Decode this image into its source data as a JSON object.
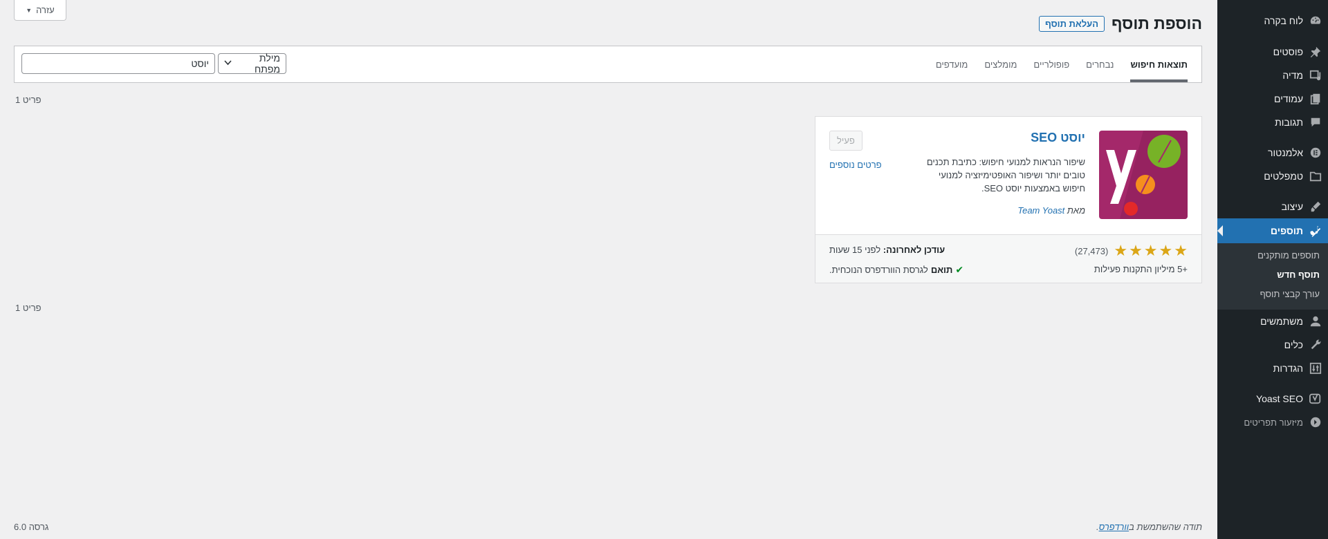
{
  "sidebar": {
    "items": [
      {
        "label": "לוח בקרה",
        "icon": "dashboard-icon"
      },
      {
        "label": "פוסטים",
        "icon": "pin-icon"
      },
      {
        "label": "מדיה",
        "icon": "media-icon"
      },
      {
        "label": "עמודים",
        "icon": "page-icon"
      },
      {
        "label": "תגובות",
        "icon": "comment-icon"
      },
      {
        "label": "אלמנטור",
        "icon": "elementor-icon"
      },
      {
        "label": "טמפלטים",
        "icon": "folder-icon"
      },
      {
        "label": "עיצוב",
        "icon": "brush-icon"
      },
      {
        "label": "תוספים",
        "icon": "plugin-icon"
      },
      {
        "label": "משתמשים",
        "icon": "user-icon"
      },
      {
        "label": "כלים",
        "icon": "wrench-icon"
      },
      {
        "label": "הגדרות",
        "icon": "settings-icon"
      },
      {
        "label": "Yoast SEO",
        "icon": "yoast-icon"
      },
      {
        "label": "מיזעור תפריטים",
        "icon": "collapse-icon"
      }
    ],
    "submenu": [
      "תוספים מותקנים",
      "תוסף חדש",
      "עורך קבצי תוסף"
    ]
  },
  "header": {
    "help": "עזרה",
    "title": "הוספת תוסף",
    "upload": "העלאת תוסף"
  },
  "filter": {
    "tabs": [
      "תוצאות חיפוש",
      "נבחרים",
      "פופולריים",
      "מומלצים",
      "מועדפים"
    ],
    "search_type": "מילת מפתח",
    "search_value": "יוסט"
  },
  "count": "פריט 1",
  "plugin": {
    "name": "יוסט SEO",
    "description": "שיפור הנראות למנועי חיפוש: כתיבת תכנים טובים יותר ושיפור האופטימיזציה למנועי חיפוש באמצעות יוסט SEO.",
    "by": "מאת",
    "author": "Team Yoast",
    "active": "פעיל",
    "more_details": "פרטים נוספים",
    "stars": 5,
    "rating_count": "(27,473)",
    "installs": "+5 מיליון התקנות פעילות",
    "last_updated_label": "עודכן לאחרונה:",
    "last_updated_value": "לפני 15 שעות",
    "compat_bold": "תואם",
    "compat_rest": "לגרסת הוורדפרס הנוכחית."
  },
  "footer": {
    "thanks_prefix": "תודה שהשתמשת ב",
    "wp_link": "וורדפרס",
    "thanks_suffix": ".",
    "version": "גרסה 6.0"
  },
  "colors": {
    "sidebar_bg": "#1d2327",
    "accent": "#2271b1",
    "star": "#dba617",
    "yoast_bg": "#a4286a"
  }
}
